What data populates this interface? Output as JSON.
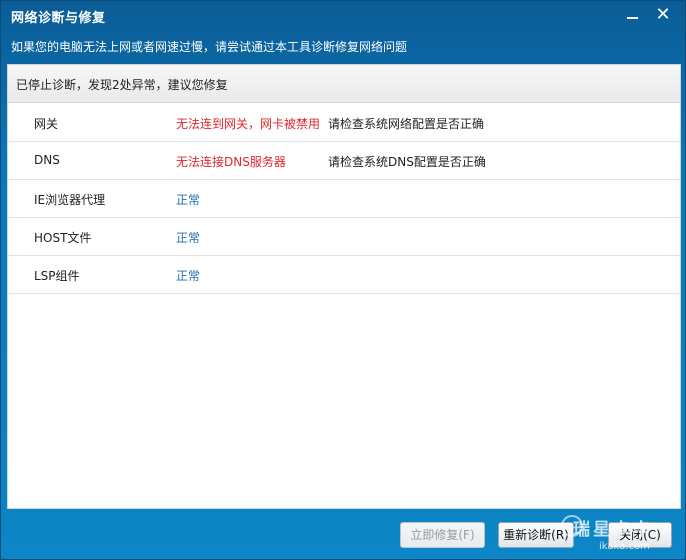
{
  "window": {
    "title": "网络诊断与修复",
    "subtitle": "如果您的电脑无法上网或者网速过慢，请尝试通过本工具诊断修复网络问题",
    "minimize_icon": "minimize-icon",
    "close_icon": "close-icon"
  },
  "status": {
    "text": "已停止诊断，发现2处异常，建议您修复"
  },
  "rows": [
    {
      "name": "网关",
      "result": "无法连到网关，网卡被禁用",
      "advice": "请检查系统网络配置是否正确",
      "state": "error"
    },
    {
      "name": "DNS",
      "result": "无法连接DNS服务器",
      "advice": "请检查系统DNS配置是否正确",
      "state": "error"
    },
    {
      "name": "IE浏览器代理",
      "result": "正常",
      "advice": "",
      "state": "ok"
    },
    {
      "name": "HOST文件",
      "result": "正常",
      "advice": "",
      "state": "ok"
    },
    {
      "name": "LSP组件",
      "result": "正常",
      "advice": "",
      "state": "ok"
    }
  ],
  "buttons": {
    "repair": "立即修复(F)",
    "rediagnose": "重新诊断(R)",
    "close": "关闭(C)"
  },
  "watermark": {
    "line1": "瑞星卡卡",
    "line2": "ikaka.com"
  },
  "colors": {
    "error": "#e0262c",
    "ok": "#1f6fb5",
    "titlebar": "#0b5c96"
  }
}
